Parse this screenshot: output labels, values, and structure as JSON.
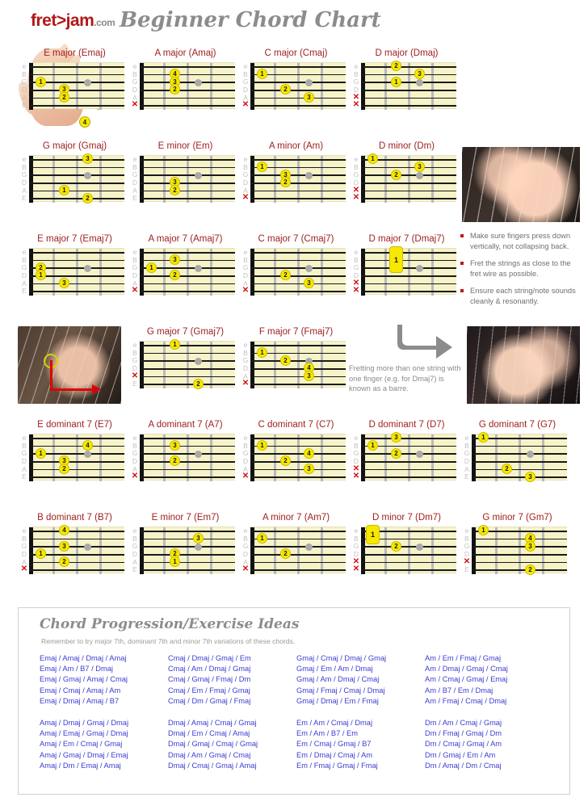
{
  "header": {
    "logo_main": "fret>jam",
    "logo_suffix": ".com",
    "title": "Beginner Chord Chart"
  },
  "hand_numbers": [
    "1",
    "2",
    "3",
    "4"
  ],
  "string_labels": [
    "e",
    "B",
    "G",
    "D",
    "A",
    "E"
  ],
  "colors": {
    "chord_name": "#9e1d1d",
    "fretboard": "#f7f3c9",
    "dot": "#f7e800",
    "mute": "#d41010",
    "progression_text": "#3c3cd2",
    "tip_text": "#6f6f6f"
  },
  "chords": [
    {
      "name": "E major (Emaj)",
      "col": 1,
      "row": 1,
      "dots": [
        {
          "s": 3,
          "f": 1,
          "t": "1"
        },
        {
          "s": 4,
          "f": 2,
          "t": "3"
        },
        {
          "s": 5,
          "f": 2,
          "t": "2"
        }
      ],
      "muted": []
    },
    {
      "name": "A major (Amaj)",
      "col": 2,
      "row": 1,
      "dots": [
        {
          "s": 2,
          "f": 2,
          "t": "4"
        },
        {
          "s": 3,
          "f": 2,
          "t": "3"
        },
        {
          "s": 4,
          "f": 2,
          "t": "2"
        }
      ],
      "muted": [
        6
      ]
    },
    {
      "name": "C major (Cmaj)",
      "col": 3,
      "row": 1,
      "dots": [
        {
          "s": 2,
          "f": 1,
          "t": "1"
        },
        {
          "s": 4,
          "f": 2,
          "t": "2"
        },
        {
          "s": 5,
          "f": 3,
          "t": "3"
        }
      ],
      "muted": [
        6
      ]
    },
    {
      "name": "D major (Dmaj)",
      "col": 4,
      "row": 1,
      "dots": [
        {
          "s": 1,
          "f": 2,
          "t": "2"
        },
        {
          "s": 2,
          "f": 3,
          "t": "3"
        },
        {
          "s": 3,
          "f": 2,
          "t": "1"
        }
      ],
      "muted": [
        5,
        6
      ]
    },
    {
      "name": "G major (Gmaj)",
      "col": 1,
      "row": 2,
      "dots": [
        {
          "s": 1,
          "f": 3,
          "t": "3"
        },
        {
          "s": 5,
          "f": 2,
          "t": "1"
        },
        {
          "s": 6,
          "f": 3,
          "t": "2"
        }
      ],
      "muted": []
    },
    {
      "name": "E minor (Em)",
      "col": 2,
      "row": 2,
      "dots": [
        {
          "s": 4,
          "f": 2,
          "t": "3"
        },
        {
          "s": 5,
          "f": 2,
          "t": "2"
        }
      ],
      "muted": []
    },
    {
      "name": "A minor (Am)",
      "col": 3,
      "row": 2,
      "dots": [
        {
          "s": 2,
          "f": 1,
          "t": "1"
        },
        {
          "s": 3,
          "f": 2,
          "t": "3"
        },
        {
          "s": 4,
          "f": 2,
          "t": "2"
        }
      ],
      "muted": [
        6
      ]
    },
    {
      "name": "D minor (Dm)",
      "col": 4,
      "row": 2,
      "dots": [
        {
          "s": 1,
          "f": 1,
          "t": "1"
        },
        {
          "s": 2,
          "f": 3,
          "t": "3"
        },
        {
          "s": 3,
          "f": 2,
          "t": "2"
        }
      ],
      "muted": [
        5,
        6
      ]
    },
    {
      "name": "E major 7 (Emaj7)",
      "col": 1,
      "row": 3,
      "dots": [
        {
          "s": 3,
          "f": 1,
          "t": "2"
        },
        {
          "s": 4,
          "f": 1,
          "t": "1"
        },
        {
          "s": 5,
          "f": 2,
          "t": "3"
        }
      ],
      "muted": []
    },
    {
      "name": "A major 7 (Amaj7)",
      "col": 2,
      "row": 3,
      "dots": [
        {
          "s": 2,
          "f": 2,
          "t": "3"
        },
        {
          "s": 3,
          "f": 1,
          "t": "1"
        },
        {
          "s": 4,
          "f": 2,
          "t": "2"
        }
      ],
      "muted": [
        6
      ]
    },
    {
      "name": "C major 7 (Cmaj7)",
      "col": 3,
      "row": 3,
      "dots": [
        {
          "s": 4,
          "f": 2,
          "t": "2"
        },
        {
          "s": 5,
          "f": 3,
          "t": "3"
        }
      ],
      "muted": [
        6
      ]
    },
    {
      "name": "D major 7 (Dmaj7)",
      "col": 4,
      "row": 3,
      "dots": [],
      "barres": [
        {
          "f": 2,
          "from": 1,
          "to": 3,
          "t": "1"
        }
      ],
      "muted": [
        5,
        6
      ]
    },
    {
      "name": "G major 7 (Gmaj7)",
      "col": 2,
      "row": 4,
      "dots": [
        {
          "s": 1,
          "f": 2,
          "t": "1"
        },
        {
          "s": 6,
          "f": 3,
          "t": "2"
        }
      ],
      "muted": [
        5
      ]
    },
    {
      "name": "F major 7 (Fmaj7)",
      "col": 3,
      "row": 4,
      "dots": [
        {
          "s": 2,
          "f": 1,
          "t": "1"
        },
        {
          "s": 3,
          "f": 2,
          "t": "2"
        },
        {
          "s": 4,
          "f": 3,
          "t": "4"
        },
        {
          "s": 5,
          "f": 3,
          "t": "3"
        }
      ],
      "muted": [
        6
      ]
    },
    {
      "name": "E dominant 7 (E7)",
      "col": 1,
      "row": 5,
      "dots": [
        {
          "s": 2,
          "f": 3,
          "t": "4"
        },
        {
          "s": 3,
          "f": 1,
          "t": "1"
        },
        {
          "s": 4,
          "f": 2,
          "t": "3"
        },
        {
          "s": 5,
          "f": 2,
          "t": "2"
        }
      ],
      "muted": []
    },
    {
      "name": "A dominant 7 (A7)",
      "col": 2,
      "row": 5,
      "dots": [
        {
          "s": 2,
          "f": 2,
          "t": "3"
        },
        {
          "s": 4,
          "f": 2,
          "t": "2"
        }
      ],
      "muted": [
        6
      ]
    },
    {
      "name": "C dominant 7 (C7)",
      "col": 3,
      "row": 5,
      "dots": [
        {
          "s": 2,
          "f": 1,
          "t": "1"
        },
        {
          "s": 3,
          "f": 3,
          "t": "4"
        },
        {
          "s": 4,
          "f": 2,
          "t": "2"
        },
        {
          "s": 5,
          "f": 3,
          "t": "3"
        }
      ],
      "muted": [
        6
      ]
    },
    {
      "name": "D dominant 7 (D7)",
      "col": 4,
      "row": 5,
      "dots": [
        {
          "s": 1,
          "f": 2,
          "t": "3"
        },
        {
          "s": 2,
          "f": 1,
          "t": "1"
        },
        {
          "s": 3,
          "f": 2,
          "t": "2"
        }
      ],
      "muted": [
        5,
        6
      ]
    },
    {
      "name": "G dominant 7 (G7)",
      "col": 5,
      "row": 5,
      "dots": [
        {
          "s": 1,
          "f": 1,
          "t": "1"
        },
        {
          "s": 5,
          "f": 2,
          "t": "2"
        },
        {
          "s": 6,
          "f": 3,
          "t": "3"
        }
      ],
      "muted": []
    },
    {
      "name": "B dominant 7 (B7)",
      "col": 1,
      "row": 6,
      "dots": [
        {
          "s": 1,
          "f": 2,
          "t": "4"
        },
        {
          "s": 3,
          "f": 2,
          "t": "3"
        },
        {
          "s": 4,
          "f": 1,
          "t": "1"
        },
        {
          "s": 5,
          "f": 2,
          "t": "2"
        }
      ],
      "muted": [
        6
      ]
    },
    {
      "name": "E minor 7 (Em7)",
      "col": 2,
      "row": 6,
      "dots": [
        {
          "s": 2,
          "f": 3,
          "t": "3"
        },
        {
          "s": 4,
          "f": 2,
          "t": "2"
        },
        {
          "s": 5,
          "f": 2,
          "t": "1"
        }
      ],
      "muted": []
    },
    {
      "name": "A minor 7 (Am7)",
      "col": 3,
      "row": 6,
      "dots": [
        {
          "s": 2,
          "f": 1,
          "t": "1"
        },
        {
          "s": 4,
          "f": 2,
          "t": "2"
        }
      ],
      "muted": [
        6
      ]
    },
    {
      "name": "D minor 7 (Dm7)",
      "col": 4,
      "row": 6,
      "dots": [
        {
          "s": 3,
          "f": 2,
          "t": "2"
        }
      ],
      "barres": [
        {
          "f": 1,
          "from": 1,
          "to": 2,
          "t": "1"
        }
      ],
      "muted": [
        5,
        6
      ]
    },
    {
      "name": "G minor 7 (Gm7)",
      "col": 5,
      "row": 6,
      "dots": [
        {
          "s": 1,
          "f": 1,
          "t": "1"
        },
        {
          "s": 2,
          "f": 3,
          "t": "4"
        },
        {
          "s": 3,
          "f": 3,
          "t": "3"
        },
        {
          "s": 6,
          "f": 3,
          "t": "2"
        }
      ],
      "muted": [
        5
      ]
    }
  ],
  "tips": [
    "Make sure fingers press down vertically, not collapsing back.",
    "Fret the strings as close to the fret wire as possible.",
    "Ensure each string/note sounds cleanly & resonantly."
  ],
  "barre_note": "Fretting more than one string with one finger (e.g. for Dmaj7) is known as a barre.",
  "bottom_panel": {
    "title": "Chord Progression/Exercise Ideas",
    "subtitle": "Remember to try major 7th, dominant 7th and minor 7th variations of these chords.",
    "blocks": [
      {
        "lines": [
          "Emaj / Amaj / Dmaj / Amaj",
          "Emaj / Am / B7 / Dmaj",
          "Emaj / Gmaj / Amaj / Cmaj",
          "Emaj / Cmaj / Amaj / Am",
          "Emaj / Dmaj / Amaj / B7"
        ]
      },
      {
        "lines": [
          "Cmaj / Dmaj / Gmaj / Em",
          "Cmaj / Am / Dmaj / Gmaj",
          "Cmaj / Gmaj / Fmaj / Dm",
          "Cmaj / Em / Fmaj / Gmaj",
          "Cmaj / Dm / Gmaj / Fmaj"
        ]
      },
      {
        "lines": [
          "Gmaj / Cmaj / Dmaj / Gmaj",
          "Gmaj / Em / Am / Dmaj",
          "Gmaj / Am / Dmaj / Cmaj",
          "Gmaj / Fmaj / Cmaj / Dmaj",
          "Gmaj / Dmaj / Em / Fmaj"
        ]
      },
      {
        "lines": [
          "Am / Em / Fmaj / Gmaj",
          "Am / Dmaj / Gmaj / Cmaj",
          "Am / Cmaj / Gmaj / Emaj",
          "Am / B7 / Em / Dmaj",
          "Am / Fmaj / Cmaj / Dmaj"
        ]
      },
      {
        "lines": [
          "Amaj / Dmaj / Gmaj / Dmaj",
          "Amaj / Emaj / Gmaj / Dmaj",
          "Amaj / Em / Cmaj / Gmaj",
          "Amaj / Gmaj / Dmaj / Emaj",
          "Amaj / Dm / Emaj / Amaj"
        ]
      },
      {
        "lines": [
          "Dmaj / Amaj / Cmaj / Gmaj",
          "Dmaj / Em / Cmaj / Amaj",
          "Dmaj / Gmaj / Cmaj / Gmaj",
          "Dmaj / Am / Gmaj / Cmaj",
          "Dmaj / Cmaj / Gmaj / Amaj"
        ]
      },
      {
        "lines": [
          "Em / Am / Cmaj / Dmaj",
          "Em / Am / B7 / Em",
          "Em / Cmaj / Gmaj / B7",
          "Em / Dmaj / Cmaj / Am",
          "Em / Fmaj / Gmaj / Fmaj"
        ]
      },
      {
        "lines": [
          "Dm / Am / Cmaj / Gmaj",
          "Dm / Fmaj / Gmaj / Dm",
          "Dm / Cmaj / Gmaj / Am",
          "Dm / Gmaj / Em / Am",
          "Dm / Amaj / Dm / Cmaj"
        ]
      }
    ]
  }
}
